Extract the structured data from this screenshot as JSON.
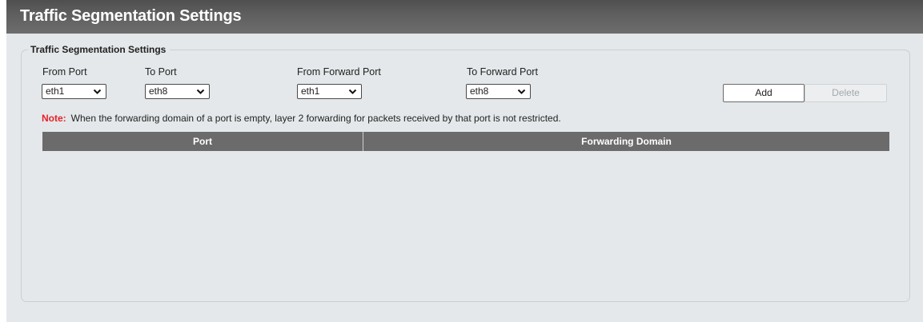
{
  "header": {
    "title": "Traffic Segmentation Settings"
  },
  "panel": {
    "legend": "Traffic Segmentation Settings",
    "fields": [
      {
        "label": "From Port",
        "value": "eth1"
      },
      {
        "label": "To Port",
        "value": "eth8"
      },
      {
        "label": "From Forward Port",
        "value": "eth1"
      },
      {
        "label": "To Forward Port",
        "value": "eth8"
      }
    ],
    "buttons": {
      "add": "Add",
      "delete": "Delete"
    },
    "note": {
      "label": "Note:",
      "text": "When the forwarding domain of a port is empty, layer 2 forwarding for packets received by that port is not restricted."
    }
  },
  "table": {
    "columns": [
      "Port",
      "Forwarding Domain"
    ],
    "rows": []
  },
  "colors": {
    "header_bg": "#5e5e5e",
    "content_bg": "#e4e8ea",
    "table_header_bg": "#6b6b6b",
    "note_label": "#e8202a",
    "disabled_text": "#a3a8ab"
  },
  "icons": {
    "select_arrow": "chevron-down-icon"
  }
}
